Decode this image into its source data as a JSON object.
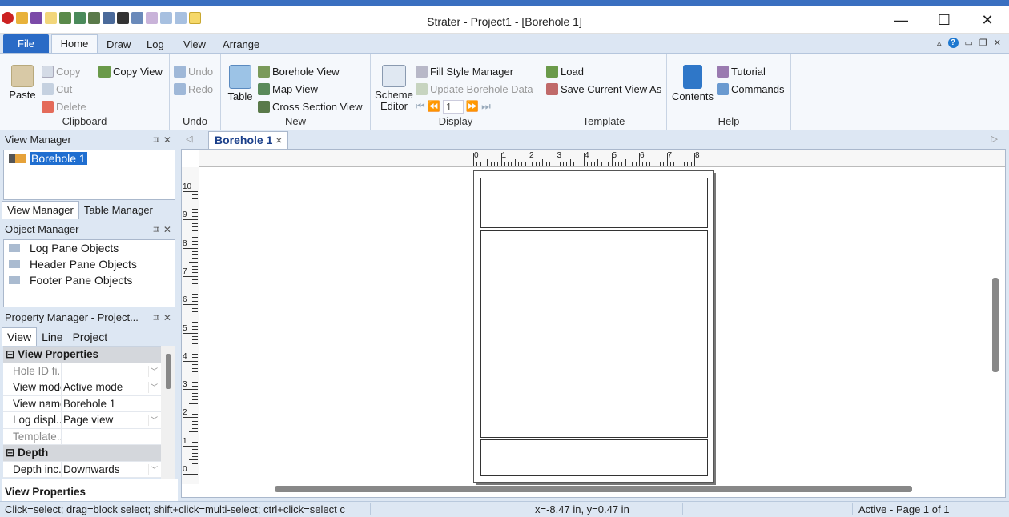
{
  "window": {
    "title": "Strater - Project1 - [Borehole 1]",
    "min": "—",
    "max": "☐",
    "close": "✕"
  },
  "menu": {
    "file": "File",
    "home": "Home",
    "draw": "Draw",
    "log": "Log",
    "view": "View",
    "arrange": "Arrange",
    "help_glyph": "?"
  },
  "ribbon": {
    "clipboard": {
      "label": "Clipboard",
      "paste": "Paste",
      "copy": "Copy",
      "cut": "Cut",
      "delete": "Delete",
      "copy_view": "Copy View"
    },
    "undo": {
      "label": "Undo",
      "undo": "Undo",
      "redo": "Redo"
    },
    "new": {
      "label": "New",
      "table": "Table",
      "borehole_view": "Borehole View",
      "map_view": "Map View",
      "cross_section_view": "Cross Section View"
    },
    "display": {
      "label": "Display",
      "scheme_editor_1": "Scheme",
      "scheme_editor_2": "Editor",
      "fill_style_manager": "Fill Style Manager",
      "update_borehole_data": "Update Borehole Data",
      "page_value": "1"
    },
    "template": {
      "label": "Template",
      "load": "Load",
      "save_current_view_as": "Save Current View As"
    },
    "help": {
      "label": "Help",
      "contents": "Contents",
      "tutorial": "Tutorial",
      "commands": "Commands"
    }
  },
  "view_manager": {
    "title": "View Manager",
    "item": "Borehole 1",
    "tab_view": "View Manager",
    "tab_table": "Table Manager"
  },
  "object_manager": {
    "title": "Object Manager",
    "items": [
      "Log Pane Objects",
      "Header Pane Objects",
      "Footer Pane Objects"
    ]
  },
  "property_manager": {
    "title": "Property Manager - Project...",
    "tabs": [
      "View",
      "Line",
      "Project"
    ],
    "sec_view": "View Properties",
    "rows": [
      {
        "k": "Hole ID fi...",
        "v": ""
      },
      {
        "k": "View mode",
        "v": "Active mode"
      },
      {
        "k": "View name",
        "v": "Borehole 1"
      },
      {
        "k": "Log displ...",
        "v": "Page view"
      },
      {
        "k": "Template...",
        "v": ""
      }
    ],
    "sec_depth": "Depth",
    "depth_rows": [
      {
        "k": "Depth inc...",
        "v": "Downwards"
      }
    ],
    "footer": "View Properties"
  },
  "doc": {
    "tab": "Borehole 1",
    "close": "×"
  },
  "ruler": {
    "h": [
      "0",
      "1",
      "2",
      "3",
      "4",
      "5",
      "6",
      "7",
      "8"
    ],
    "v": [
      "10",
      "9",
      "8",
      "7",
      "6",
      "5",
      "4",
      "3",
      "2",
      "1",
      "0"
    ]
  },
  "status": {
    "hint": "Click=select; drag=block select; shift+click=multi-select; ctrl+click=select c",
    "coords": "x=-8.47 in, y=0.47 in",
    "page": "Active - Page 1 of 1"
  },
  "colors": {
    "accent": "#2a6bc6",
    "ribbon_bg": "#f5f8fc",
    "chrome": "#dde7f3"
  }
}
